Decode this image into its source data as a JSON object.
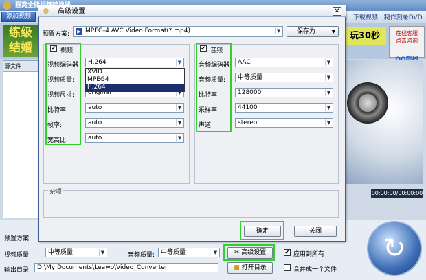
{
  "app": {
    "title": "狸窝全能视频转换器",
    "add_video_label": "添加视频",
    "top_links": [
      "战",
      "下载视频",
      "制作刻录DVD"
    ],
    "ad_left_text": "练级\n结婚",
    "ad_right_text": "玩30秒",
    "ad_service_text": "在线客服\n点击咨询",
    "ad_qq_text": "QQ在线",
    "source_header": "源文件",
    "time_readout": "00:00:00/00:00:00",
    "bottom": {
      "preset_label": "预置方案:",
      "video_quality_label": "视频质量:",
      "video_quality_value": "中等质量",
      "audio_quality_label": "音频质量:",
      "audio_quality_value": "中等质量",
      "advanced_button": "高级设置",
      "apply_all_label": "应用到所有",
      "output_label": "输出目录:",
      "output_path": "D:\\My Documents\\Leawo\\Video_Converter",
      "open_dir_button": "打开目录",
      "merge_label": "合并成一个文件"
    }
  },
  "dialog": {
    "title": "高级设置",
    "close_glyph": "✕",
    "preset_label": "预置方案:",
    "preset_value": "MPEG-4 AVC Video Format(*.mp4)",
    "save_as_button": "保存为",
    "video_section": {
      "checkbox_label": "视频",
      "checked": true,
      "fields": [
        {
          "label": "视频编码器",
          "value": "H.264"
        },
        {
          "label": "视频质量:",
          "value": ""
        },
        {
          "label": "视频尺寸:",
          "value": "original"
        },
        {
          "label": "比特率:",
          "value": "auto"
        },
        {
          "label": "帧率:",
          "value": "auto"
        },
        {
          "label": "宽高比:",
          "value": "auto"
        }
      ],
      "codec_options": [
        "XVID",
        "MPEG4",
        "H.264"
      ],
      "codec_selected_index": 2
    },
    "audio_section": {
      "checkbox_label": "音频",
      "checked": true,
      "fields": [
        {
          "label": "音频编码器",
          "value": "AAC"
        },
        {
          "label": "音频质量:",
          "value": "中等质量"
        },
        {
          "label": "比特率:",
          "value": "128000"
        },
        {
          "label": "采样率:",
          "value": "44100"
        },
        {
          "label": "声道:",
          "value": "stereo"
        }
      ]
    },
    "misc_label": "杂项",
    "ok_button": "确定",
    "close_button": "关闭"
  },
  "colors": {
    "highlight": "#2fd12f",
    "selected_item": "#1b2e6b"
  }
}
